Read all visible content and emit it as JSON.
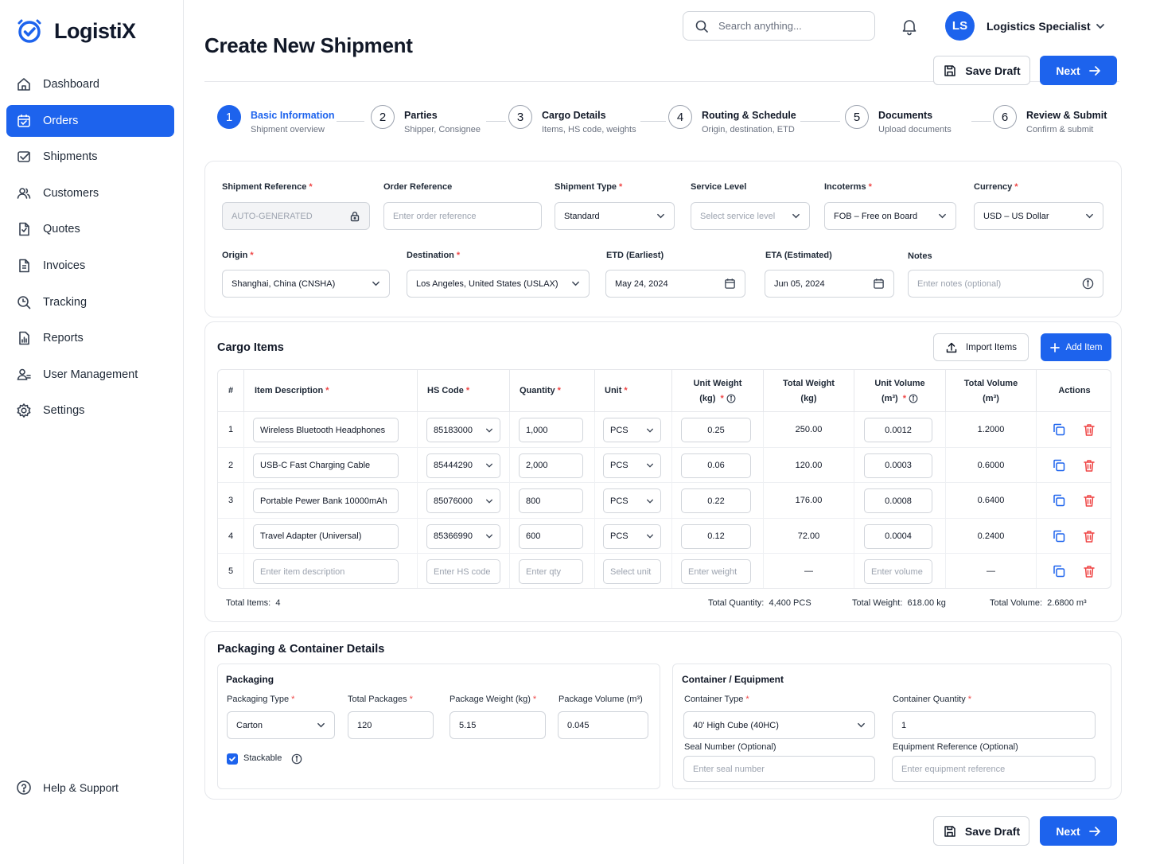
{
  "app": {
    "name": "LogistiX"
  },
  "colors": {
    "primary": "#1d63ed",
    "danger": "#ef4444",
    "border": "#d1d5db"
  },
  "sidebar": {
    "items": [
      {
        "label": "Dashboard",
        "icon": "home-icon"
      },
      {
        "label": "Orders",
        "icon": "calendar-icon",
        "active": true
      },
      {
        "label": "Shipments",
        "icon": "shipment-icon"
      },
      {
        "label": "Customers",
        "icon": "users-icon"
      },
      {
        "label": "Quotes",
        "icon": "document-icon"
      },
      {
        "label": "Invoices",
        "icon": "invoice-icon"
      },
      {
        "label": "Tracking",
        "icon": "search-icon"
      },
      {
        "label": "Reports",
        "icon": "chart-icon"
      },
      {
        "label": "User Management",
        "icon": "user-group-icon"
      },
      {
        "label": "Settings",
        "icon": "gear-icon"
      }
    ],
    "help_label": "Help & Support"
  },
  "header": {
    "title": "Create New Shipment",
    "search_placeholder": "Search anything...",
    "user_initials": "LS",
    "user_name": "Logistics Specialist",
    "save_draft_label": "Save Draft",
    "next_label": "Next"
  },
  "steps": [
    {
      "num": "1",
      "title": "Basic Information",
      "sub": "Shipment overview",
      "active": true
    },
    {
      "num": "2",
      "title": "Parties",
      "sub": "Shipper, Consignee"
    },
    {
      "num": "3",
      "title": "Cargo Details",
      "sub": "Items, HS code, weights"
    },
    {
      "num": "4",
      "title": "Routing & Schedule",
      "sub": "Origin, destination, ETD"
    },
    {
      "num": "5",
      "title": "Documents",
      "sub": "Upload documents"
    },
    {
      "num": "6",
      "title": "Review & Submit",
      "sub": "Confirm & submit"
    }
  ],
  "basic": {
    "shipment_reference": {
      "label": "Shipment Reference",
      "value": "AUTO-GENERATED"
    },
    "order_reference": {
      "label": "Order Reference",
      "placeholder": "Enter order reference"
    },
    "shipment_type": {
      "label": "Shipment Type",
      "value": "Standard"
    },
    "service_level": {
      "label": "Service Level",
      "placeholder": "Select service level"
    },
    "incoterms": {
      "label": "Incoterms",
      "value": "FOB – Free on Board"
    },
    "currency": {
      "label": "Currency",
      "value": "USD – US Dollar"
    },
    "origin": {
      "label": "Origin",
      "value": "Shanghai, China (CNSHA)"
    },
    "destination": {
      "label": "Destination",
      "value": "Los Angeles, United States (USLAX)"
    },
    "etd": {
      "label": "ETD (Earliest)",
      "value": "May 24, 2024"
    },
    "eta": {
      "label": "ETA (Estimated)",
      "value": "Jun 05, 2024"
    },
    "notes": {
      "label": "Notes",
      "placeholder": "Enter notes (optional)"
    }
  },
  "cargo": {
    "title": "Cargo Items",
    "import_label": "Import Items",
    "add_label": "Add Item",
    "columns": {
      "num": "#",
      "desc": "Item Description",
      "hs": "HS Code",
      "qty": "Quantity",
      "unit": "Unit",
      "unit_weight_1": "Unit Weight",
      "unit_weight_2": "(kg)",
      "total_weight_1": "Total Weight",
      "total_weight_2": "(kg)",
      "unit_volume_1": "Unit Volume",
      "unit_volume_2": "(m³)",
      "total_volume_1": "Total Volume",
      "total_volume_2": "(m³)",
      "actions": "Actions"
    },
    "rows": [
      {
        "num": "1",
        "desc": "Wireless Bluetooth Headphones",
        "hs": "85183000",
        "qty": "1,000",
        "unit": "PCS",
        "unit_weight": "0.25",
        "total_weight": "250.00",
        "unit_volume": "0.0012",
        "total_volume": "1.2000"
      },
      {
        "num": "2",
        "desc": "USB-C Fast Charging Cable",
        "hs": "85444290",
        "qty": "2,000",
        "unit": "PCS",
        "unit_weight": "0.06",
        "total_weight": "120.00",
        "unit_volume": "0.0003",
        "total_volume": "0.6000"
      },
      {
        "num": "3",
        "desc": "Portable Pewer Bank 10000mAh",
        "hs": "85076000",
        "qty": "800",
        "unit": "PCS",
        "unit_weight": "0.22",
        "total_weight": "176.00",
        "unit_volume": "0.0008",
        "total_volume": "0.6400"
      },
      {
        "num": "4",
        "desc": "Travel Adapter (Universal)",
        "hs": "85366990",
        "qty": "600",
        "unit": "PCS",
        "unit_weight": "0.12",
        "total_weight": "72.00",
        "unit_volume": "0.0004",
        "total_volume": "0.2400"
      }
    ],
    "empty_row": {
      "num": "5",
      "desc_placeholder": "Enter item description",
      "hs_placeholder": "Enter HS code",
      "qty_placeholder": "Enter qty",
      "unit_placeholder": "Select unit",
      "weight_placeholder": "Enter weight",
      "total_weight": "—",
      "volume_placeholder": "Enter volume",
      "total_volume": "—"
    },
    "totals": {
      "items_label": "Total Items:",
      "items": "4",
      "quantity_label": "Total Quantity:",
      "quantity": "4,400 PCS",
      "weight_label": "Total Weight:",
      "weight": "618.00 kg",
      "volume_label": "Total Volume:",
      "volume": "2.6800 m³"
    }
  },
  "packaging": {
    "section_title": "Packaging & Container Details",
    "packaging_title": "Packaging",
    "type": {
      "label": "Packaging Type",
      "value": "Carton"
    },
    "total_packages": {
      "label": "Total Packages",
      "value": "120"
    },
    "package_weight": {
      "label": "Package Weight (kg)",
      "value": "5.15"
    },
    "package_volume": {
      "label": "Package Volume (m³)",
      "value": "0.045"
    },
    "stackable_label": "Stackable",
    "stackable_checked": true,
    "container_title": "Container / Equipment",
    "container_type": {
      "label": "Container Type",
      "value": "40' High Cube (40HC)"
    },
    "container_quantity": {
      "label": "Container Quantity",
      "value": "1"
    },
    "seal_number": {
      "label": "Seal Number (Optional)",
      "placeholder": "Enter seal number"
    },
    "equipment_reference": {
      "label": "Equipment Reference (Optional)",
      "placeholder": "Enter equipment reference"
    }
  }
}
